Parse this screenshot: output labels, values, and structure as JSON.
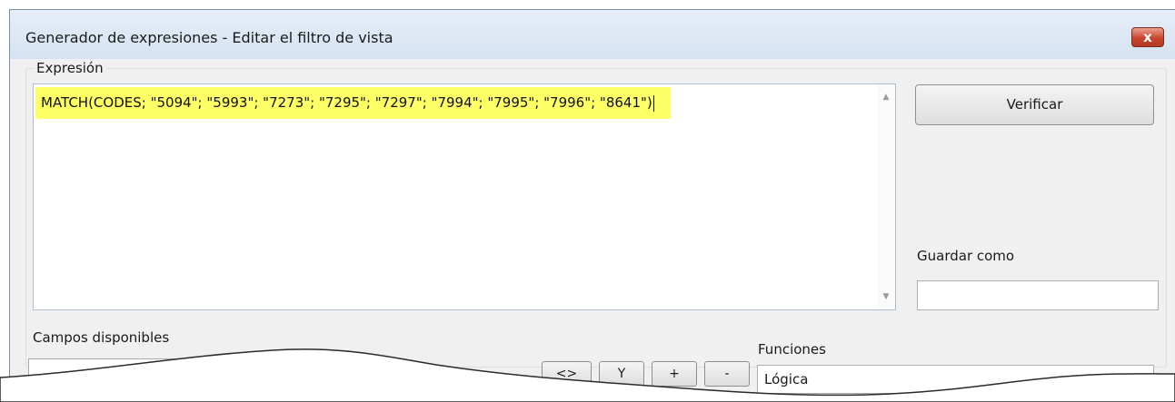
{
  "window": {
    "title": "Generador de expresiones - Editar el filtro de vista",
    "close_label": "x"
  },
  "expression": {
    "group_label": "Expresión",
    "text": "MATCH(CODES; \"5094\"; \"5993\"; \"7273\"; \"7295\"; \"7297\"; \"7994\"; \"7995\"; \"7996\"; \"8641\")"
  },
  "actions": {
    "verify_label": "Verificar",
    "save_as_label": "Guardar como",
    "save_as_value": ""
  },
  "fields": {
    "label": "Campos disponibles"
  },
  "operators": [
    "<>",
    "Y",
    "+",
    "-"
  ],
  "functions": {
    "label": "Funciones",
    "selected": "Lógica"
  },
  "colors": {
    "highlight": "#ffff66",
    "close_button": "#c8462e"
  }
}
